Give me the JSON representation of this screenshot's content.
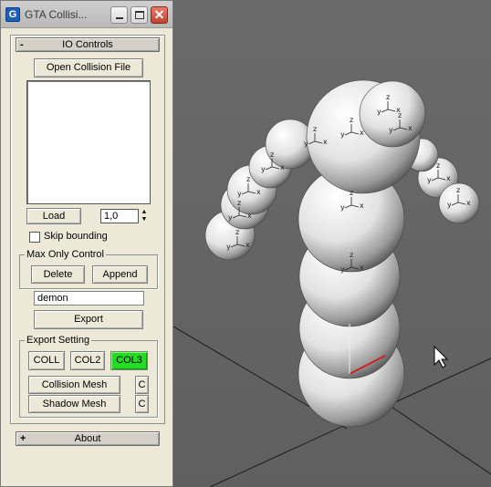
{
  "window": {
    "title": "GTA Collisi...",
    "icon_letter": "G"
  },
  "io_rollout": {
    "toggle": "-",
    "title": "IO Controls",
    "open_button": "Open Collision File",
    "load_button": "Load",
    "spinner_value": "1,0",
    "skip_bounding_label": "Skip bounding",
    "skip_bounding_checked": false
  },
  "max_only": {
    "group_label": "Max Only Control",
    "delete_button": "Delete",
    "append_button": "Append",
    "name_value": "demon",
    "export_button": "Export"
  },
  "export_setting": {
    "group_label": "Export Setting",
    "coll_button": "COLL",
    "col2_button": "COL2",
    "col3_button": "COL3",
    "active_format": "COL3",
    "active_color": "#22dd22",
    "collision_mesh_button": "Collision Mesh",
    "shadow_mesh_button": "Shadow Mesh",
    "c_button": "C"
  },
  "about_rollout": {
    "toggle": "+",
    "title": "About"
  },
  "viewport": {
    "gizmo_labels": {
      "z": "z",
      "y": "y",
      "x": "x"
    },
    "cursor_icon": "mouse-pointer-icon"
  }
}
